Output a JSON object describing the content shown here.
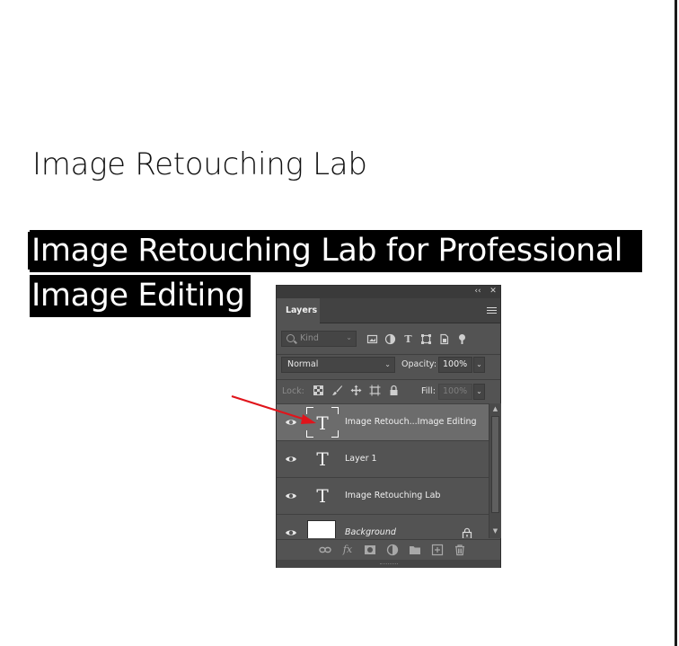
{
  "document": {
    "title_text": "Image Retouching Lab",
    "selected_text_line1": "Image Retouching Lab for Professional",
    "selected_text_line2": "Image Editing"
  },
  "panel": {
    "collapse_glyph": "‹‹",
    "close_glyph": "✕",
    "tab_label": "Layers",
    "filter": {
      "placeholder": "Kind",
      "icons": [
        "image-filter-icon",
        "adjustment-filter-icon",
        "type-filter-icon",
        "shape-filter-icon",
        "smart-object-filter-icon",
        "filter-toggle-icon"
      ]
    },
    "blend_mode": "Normal",
    "opacity_label": "Opacity:",
    "opacity_value": "100%",
    "lock_label": "Lock:",
    "fill_label": "Fill:",
    "fill_value": "100%",
    "layers": [
      {
        "name": "Image Retouch...Image Editing",
        "type": "text",
        "selected": true,
        "thumb_glyph": "T"
      },
      {
        "name": "Layer 1",
        "type": "text",
        "selected": false,
        "thumb_glyph": "T"
      },
      {
        "name": "Image Retouching Lab",
        "type": "text",
        "selected": false,
        "thumb_glyph": "T"
      },
      {
        "name": "Background",
        "type": "background",
        "selected": false,
        "locked": true
      }
    ],
    "bottom_icons": [
      "link-layers-icon",
      "fx-icon",
      "add-mask-icon",
      "adjustment-layer-icon",
      "group-folder-icon",
      "new-layer-icon",
      "trash-icon"
    ],
    "fx_glyph": "fx"
  },
  "colors": {
    "panel_bg": "#535353",
    "selected_row": "#6c6c6c",
    "annotation_arrow": "#e0141b"
  }
}
